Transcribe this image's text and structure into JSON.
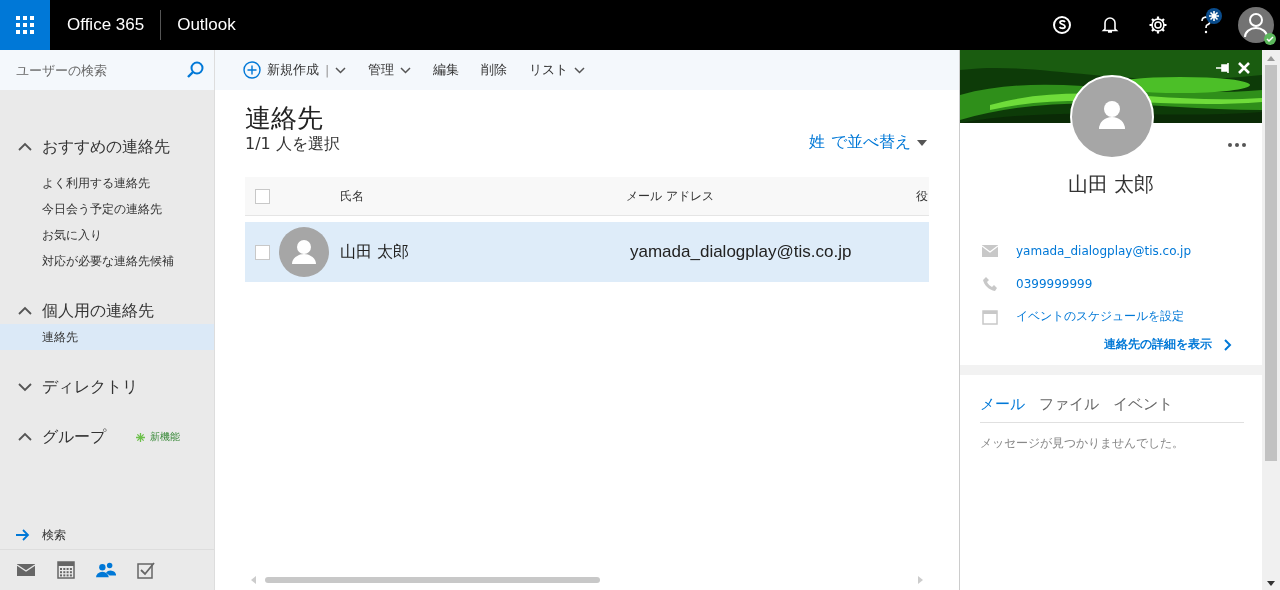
{
  "header": {
    "suite": "Office 365",
    "app": "Outlook",
    "help_badge": true,
    "presence_shown": true
  },
  "sidebar": {
    "search": {
      "placeholder": "ユーザーの検索"
    },
    "sections": [
      {
        "title": "おすすめの連絡先",
        "expanded": true,
        "items": [
          {
            "label": "よく利用する連絡先",
            "selected": false
          },
          {
            "label": "今日会う予定の連絡先",
            "selected": false
          },
          {
            "label": "お気に入り",
            "selected": false
          },
          {
            "label": "対応が必要な連絡先候補",
            "selected": false
          }
        ]
      },
      {
        "title": "個人用の連絡先",
        "expanded": true,
        "items": [
          {
            "label": "連絡先",
            "selected": true
          }
        ]
      },
      {
        "title": "ディレクトリ",
        "expanded": false
      },
      {
        "title": "グループ",
        "expanded": true,
        "badge": "新機能"
      }
    ],
    "search_link": "検索",
    "nav": [
      {
        "kind": "mail",
        "selected": false
      },
      {
        "kind": "calendar",
        "selected": false
      },
      {
        "kind": "people",
        "selected": true
      },
      {
        "kind": "tasks",
        "selected": false
      }
    ]
  },
  "toolbar": [
    {
      "kind": "new",
      "label": "新規作成",
      "separator": "|",
      "dropdown": true
    },
    {
      "kind": "plain",
      "label": "管理",
      "dropdown": true
    },
    {
      "kind": "plain",
      "label": "編集",
      "dropdown": false
    },
    {
      "kind": "plain",
      "label": "削除",
      "dropdown": false
    },
    {
      "kind": "plain",
      "label": "リスト",
      "dropdown": true
    }
  ],
  "content": {
    "title": "連絡先",
    "subtitle": "1/1 人を選択",
    "sort": {
      "field": "姓",
      "label": "で並べ替え"
    },
    "table": {
      "all_checked": false,
      "columns": [
        "氏名",
        "メール アドレス",
        "役"
      ],
      "rows": [
        {
          "name": "山田 太郎",
          "email": "yamada_dialogplay@tis.co.jp",
          "selected": true,
          "checked": false
        }
      ]
    }
  },
  "card": {
    "name": "山田 太郎",
    "details": [
      {
        "kind": "mail",
        "text": "yamada_dialogplay@tis.co.jp"
      },
      {
        "kind": "phone",
        "text": "0399999999"
      },
      {
        "kind": "calendar",
        "text": "イベントのスケジュールを設定"
      }
    ],
    "more_link": "連絡先の詳細を表示",
    "tabs": [
      {
        "label": "メール",
        "selected": true
      },
      {
        "label": "ファイル",
        "selected": false
      },
      {
        "label": "イベント",
        "selected": false
      }
    ],
    "empty_message": "メッセージが見つかりませんでした。"
  }
}
